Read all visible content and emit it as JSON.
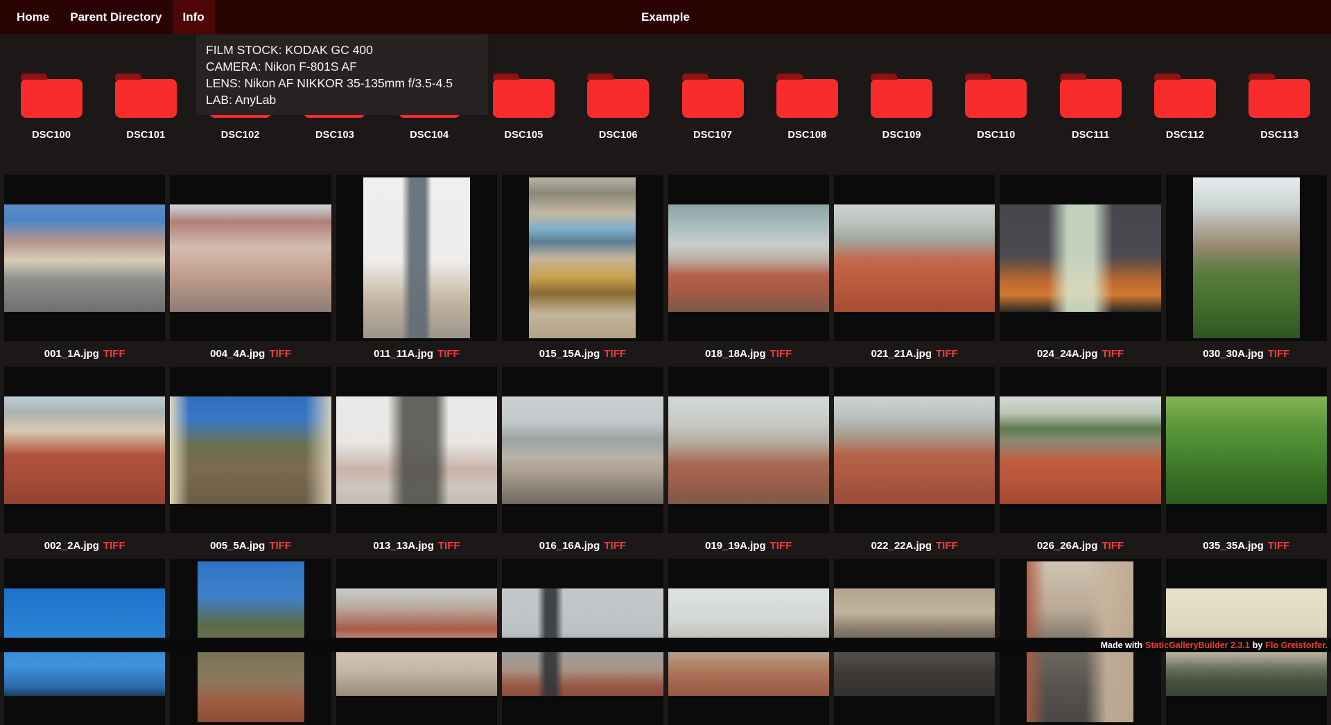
{
  "nav": {
    "items": [
      {
        "label": "Home",
        "active": false
      },
      {
        "label": "Parent Directory",
        "active": false
      },
      {
        "label": "Info",
        "active": true
      }
    ],
    "title": "Example"
  },
  "info_tooltip": {
    "lines": [
      "FILM STOCK: KODAK GC 400",
      "CAMERA: Nikon F-801S AF",
      "LENS: Nikon AF NIKKOR 35-135mm f/3.5-4.5",
      "LAB: AnyLab"
    ]
  },
  "folders": {
    "labels": [
      "DSC100",
      "DSC101",
      "DSC102",
      "DSC103",
      "DSC104",
      "DSC105",
      "DSC106",
      "DSC107",
      "DSC108",
      "DSC109",
      "DSC110",
      "DSC111",
      "DSC112",
      "DSC113"
    ]
  },
  "gallery": {
    "rows": [
      [
        {
          "filename": "001_1A.jpg",
          "format": "TIFF",
          "orientation": "landscape",
          "scene": "street-with-tram-tracks",
          "bg": "linear-gradient(180deg,#5d8ec2 0%,#4c84c6 14%,#b0958c 34%,#d8ccb8 52%,#8f8f8d 70%,#6f6f6e 100%)"
        },
        {
          "filename": "004_4A.jpg",
          "format": "TIFF",
          "orientation": "landscape",
          "scene": "rooftop-street-view",
          "bg": "linear-gradient(180deg,#ccd8e1 0%,#b08078 16%,#d4bdb0 40%,#c09a8c 68%,#8d7d76 100%)"
        },
        {
          "filename": "011_11A.jpg",
          "format": "TIFF",
          "orientation": "portrait",
          "scene": "town-hall-tower",
          "bg": "linear-gradient(90deg,rgba(93,106,116,0) 36%,rgba(93,106,116,0.9) 44%,rgba(93,106,116,0.9) 58%,rgba(93,106,116,0) 64%),linear-gradient(180deg,#f0efed 0%,#eeedeb 52%,#c3b29c 78%,#9b958d 100%)"
        },
        {
          "filename": "015_15A.jpg",
          "format": "TIFF",
          "orientation": "portrait",
          "scene": "astronomical-clock",
          "bg": "linear-gradient(180deg,#b9b4a4 0%,#8a8878 10%,#c4b8a0 22%,#7fb0cc 32%,#5d7e96 40%,#c2b49a 50%,#c9a24e 62%,#8a6a34 72%,#c4b598 85%,#b0a288 100%)"
        },
        {
          "filename": "018_18A.jpg",
          "format": "TIFF",
          "orientation": "landscape",
          "scene": "misty-city-panorama",
          "bg": "linear-gradient(180deg,#8da4a6 0%,#aebfbf 22%,#c8cdc9 38%,#b9ab9e 52%,#b5604a 66%,#a85a44 80%,#7d5948 100%)"
        },
        {
          "filename": "021_21A.jpg",
          "format": "TIFF",
          "orientation": "landscape",
          "scene": "red-roofs-and-castle",
          "bg": "linear-gradient(180deg,#ccd3d1 0%,#b9c2bd 18%,#a0a8a0 32%,#c2684c 52%,#bd5a3e 72%,#a44e36 100%)"
        },
        {
          "filename": "024_24A.jpg",
          "format": "TIFF",
          "orientation": "landscape",
          "scene": "church-towers-at-night",
          "bg": "linear-gradient(90deg,rgba(215,232,210,0) 30%,rgba(215,232,210,0.85) 42%,rgba(215,232,210,0.85) 58%,rgba(215,232,210,0) 70%),linear-gradient(180deg,#46464c 0%,#4a4a50 48%,#c06a2c 72%,#d07830 84%,#2e2a28 100%)"
        },
        {
          "filename": "030_30A.jpg",
          "format": "TIFF",
          "orientation": "portrait",
          "scene": "trees-over-city",
          "bg": "linear-gradient(180deg,#e6ecee 0%,#ccd4d2 18%,#b4aca0 30%,#9a8a74 42%,#5c7e40 58%,#46702f 76%,#2f5622 100%)"
        }
      ],
      [
        {
          "filename": "002_2A.jpg",
          "format": "TIFF",
          "orientation": "landscape",
          "scene": "rooftops-and-spires",
          "bg": "linear-gradient(180deg,#bccdd8 0%,#aab4b4 14%,#d8c8b0 32%,#b0513c 55%,#a84c38 75%,#934232 100%)"
        },
        {
          "filename": "005_5A.jpg",
          "format": "TIFF",
          "orientation": "landscape",
          "scene": "hillside-clocktower",
          "bg": "linear-gradient(90deg,rgba(232,221,194,0.95) 0%,rgba(232,221,194,0) 12%,rgba(0,0,0,0) 84%,rgba(226,214,190,0.9) 100%),linear-gradient(180deg,#2e6ec0 0%,#3a78c4 22%,#6a7050 45%,#7a6a50 68%,#6a5c46 100%)"
        },
        {
          "filename": "013_13A.jpg",
          "format": "TIFF",
          "orientation": "landscape",
          "scene": "tyn-church-spires",
          "bg": "linear-gradient(90deg,rgba(76,76,72,0) 32%,rgba(76,76,72,0.85) 42%,rgba(76,76,72,0.85) 62%,rgba(76,76,72,0) 70%),linear-gradient(180deg,#ebe9e7 0%,#e9e7e5 42%,#c9b4a8 68%,#cdc6bc 85%,#c2bcb2 100%)"
        },
        {
          "filename": "016_16A.jpg",
          "format": "TIFF",
          "orientation": "landscape",
          "scene": "river-and-castle",
          "bg": "linear-gradient(180deg,#ccd2d4 0%,#c2c8ca 24%,#9aa2a2 40%,#b8b2a8 56%,#a89c8e 72%,#6e6a62 100%)"
        },
        {
          "filename": "019_19A.jpg",
          "format": "TIFF",
          "orientation": "landscape",
          "scene": "hazy-panorama",
          "bg": "linear-gradient(180deg,#d2d8da 0%,#c6c8c4 26%,#b4a89c 44%,#a86a52 62%,#9c5e48 80%,#7e5a48 100%)"
        },
        {
          "filename": "022_22A.jpg",
          "format": "TIFF",
          "orientation": "landscape",
          "scene": "castle-over-roofs",
          "bg": "linear-gradient(180deg,#ccd4d6 0%,#bcc2c0 18%,#a8a496 34%,#b4644a 54%,#ae5840 74%,#984c38 100%)"
        },
        {
          "filename": "026_26A.jpg",
          "format": "TIFF",
          "orientation": "landscape",
          "scene": "roofs-and-green-hill",
          "bg": "linear-gradient(180deg,#d4dad6 0%,#b9c4b4 16%,#5e7c4e 30%,#8c8a74 42%,#c05e40 60%,#b85438 80%,#a04830 100%)"
        },
        {
          "filename": "035_35A.jpg",
          "format": "TIFF",
          "orientation": "landscape",
          "scene": "green-foliage",
          "bg": "linear-gradient(180deg,#86b457 0%,#5f9a3c 24%,#4a8a30 48%,#3a7226 72%,#2c5c1e 100%)"
        }
      ],
      [
        {
          "filename": null,
          "format": null,
          "orientation": "landscape",
          "scene": "blue-sky-contrail",
          "bg": "linear-gradient(180deg,#1e72c8 0%,#2a82d4 40%,#3f92dc 72%,#2a6aa8 92%,#1c3c60 100%)"
        },
        {
          "filename": null,
          "format": null,
          "orientation": "portrait",
          "scene": "hill-with-tower",
          "bg": "linear-gradient(180deg,#2e74c4 0%,#3f80c8 22%,#5c6c48 40%,#7c7258 58%,#8a7a5e 74%,#a05a40 88%,#8a4c36 100%)"
        },
        {
          "filename": null,
          "format": null,
          "orientation": "landscape",
          "scene": "ornate-facades",
          "bg": "linear-gradient(180deg,#c6ccd0 0%,#b9aa9c 18%,#a85a48 38%,#d4c4b4 58%,#c4b4a4 78%,#9a8a7c 100%)"
        },
        {
          "filename": null,
          "format": null,
          "orientation": "landscape",
          "scene": "bridge-statue-silhouette",
          "bg": "linear-gradient(90deg,rgba(50,54,58,0) 22%,rgba(50,54,58,0.9) 27%,rgba(50,54,58,0.9) 33%,rgba(50,54,58,0) 38%),linear-gradient(180deg,#c4c8ca 0%,#bcc2c4 40%,#9aa0a0 58%,#a89284 76%,#9a5a46 90%,#8a4e3c 100%)"
        },
        {
          "filename": null,
          "format": null,
          "orientation": "landscape",
          "scene": "misty-rooftops",
          "bg": "linear-gradient(180deg,#dde2e4 0%,#d2d6d4 30%,#bcbcb4 50%,#b08468 70%,#a86850 86%,#945a44 100%)"
        },
        {
          "filename": null,
          "format": null,
          "orientation": "landscape",
          "scene": "crowd-on-bridge",
          "bg": "linear-gradient(180deg,#b4a48e 0%,#c2b49c 22%,#8a7c6c 38%,#5a5350 56%,#3f3a38 78%,#343030 100%)"
        },
        {
          "filename": null,
          "format": null,
          "orientation": "portrait",
          "scene": "street-from-above",
          "bg": "linear-gradient(90deg,rgba(176,90,64,0.9) 0%,rgba(176,90,64,0) 18%,rgba(0,0,0,0) 55%,rgba(200,180,156,0.9) 75%,rgba(190,170,148,0.95) 100%),linear-gradient(180deg,#cfc4b4 0%,#b9a894 30%,#6e6860 55%,#56524e 80%,#4a4744 100%)"
        },
        {
          "filename": null,
          "format": null,
          "orientation": "landscape",
          "scene": "pale-sky-treeline",
          "bg": "linear-gradient(180deg,#e9e2cc 0%,#ded6be 38%,#c2bca8 58%,#6a7260 74%,#46523f 86%,#3a4435 100%)"
        }
      ]
    ]
  },
  "credit": {
    "prefix": "Made with",
    "builder_link": "StaticGalleryBuilder 2.3.1",
    "middle": "by",
    "author_link": "Flo Greistorfer."
  },
  "colors": {
    "page_bg": "#1c1818",
    "nav_bg": "#2a0303",
    "nav_active_bg": "#4d0707",
    "tile_bg": "#0b0b0b",
    "tooltip_bg": "#282323",
    "credit_bg": "#0a0a0a",
    "accent_red": "#f03c3c",
    "folder_red": "#f92c2c",
    "folder_tab": "#8f1313"
  }
}
